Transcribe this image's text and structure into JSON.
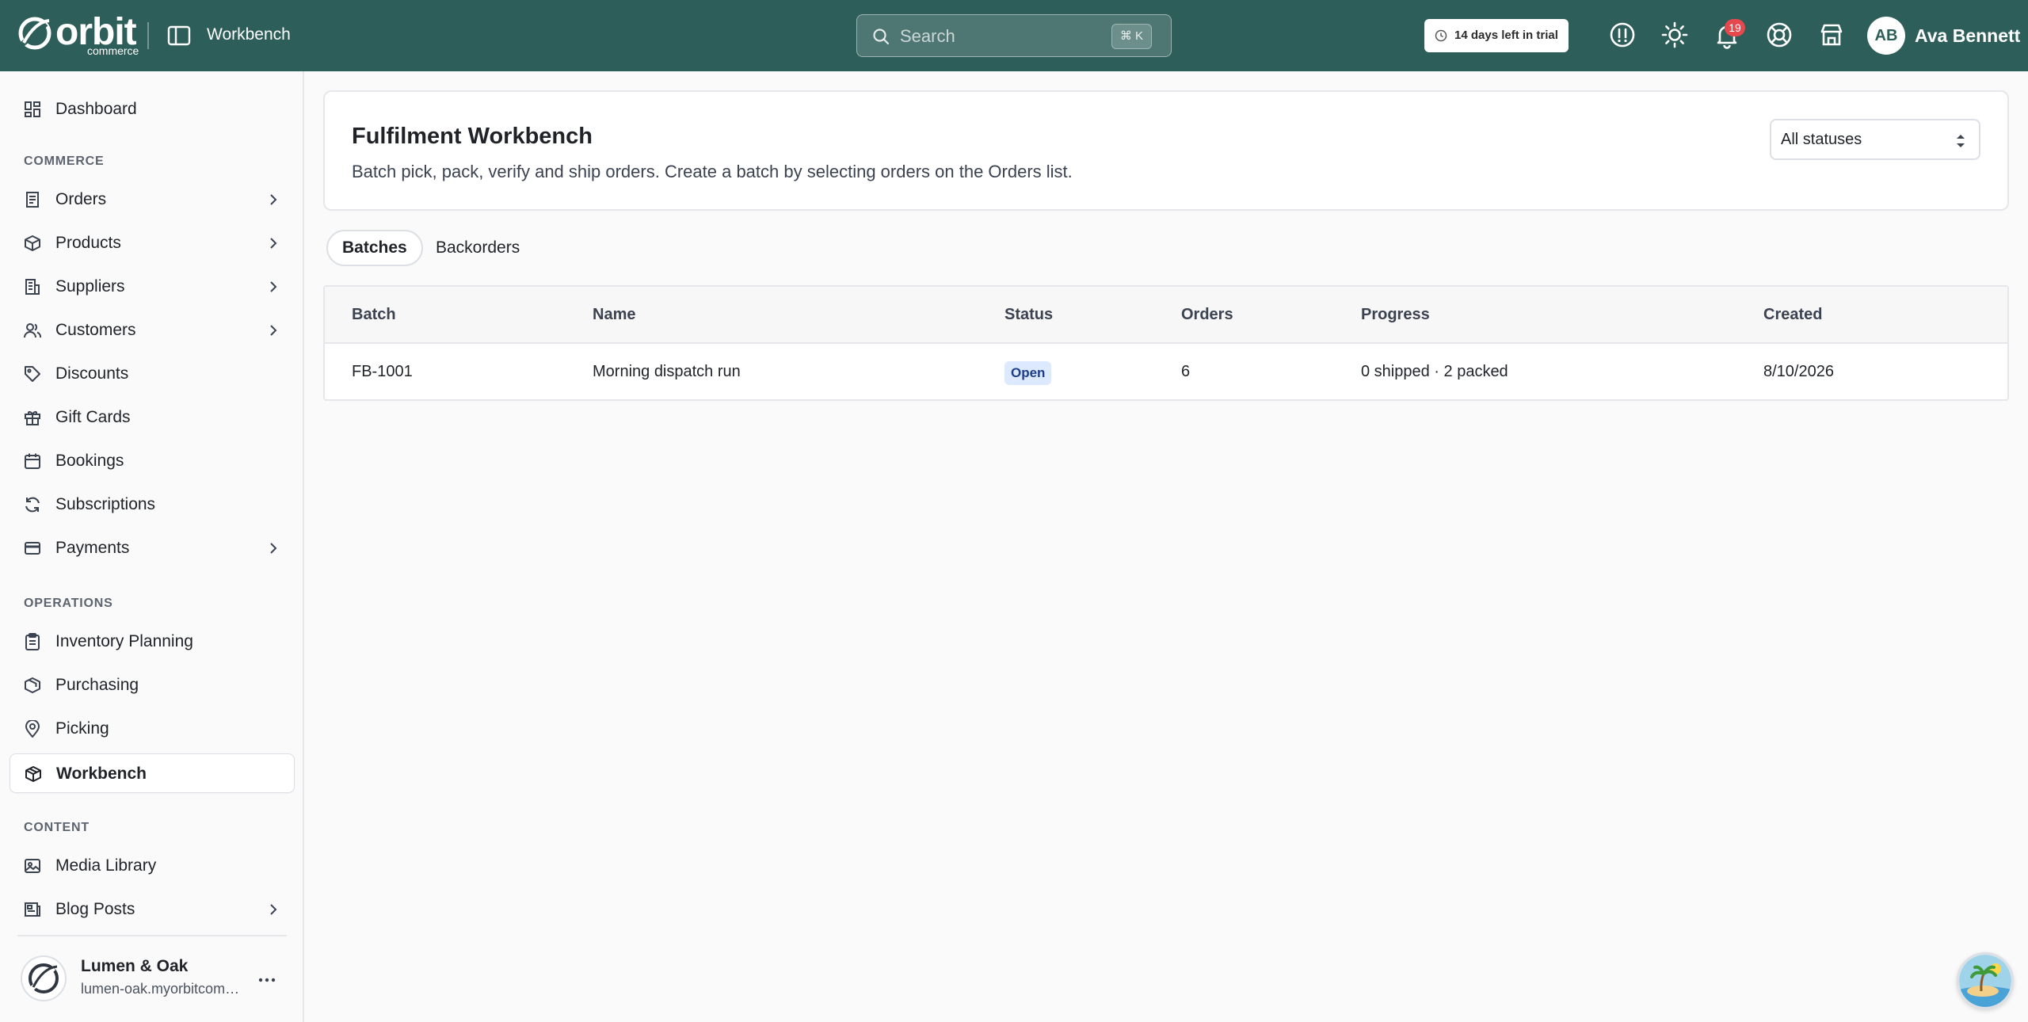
{
  "topbar": {
    "logo_word": "orbit",
    "logo_sub": "commerce",
    "page_label": "Workbench",
    "search_placeholder": "Search",
    "search_shortcut": "⌘ K",
    "trial_text": "14 days left in trial",
    "notification_count": "19",
    "user_initials": "AB",
    "user_name": "Ava Bennett",
    "icons": [
      "sidebar-toggle-icon",
      "search-icon",
      "clock-icon",
      "alert-icon",
      "sun-icon",
      "bell-icon",
      "lifebuoy-icon",
      "storefront-icon"
    ],
    "bar_color": "#2d5e59"
  },
  "sidebar": {
    "items": [
      {
        "label": "Dashboard",
        "icon": "dashboard-icon"
      },
      {
        "label": "Orders",
        "icon": "receipt-icon",
        "expandable": true
      },
      {
        "label": "Products",
        "icon": "box-icon",
        "expandable": true
      },
      {
        "label": "Suppliers",
        "icon": "building-icon",
        "expandable": true
      },
      {
        "label": "Customers",
        "icon": "users-icon",
        "expandable": true
      },
      {
        "label": "Discounts",
        "icon": "tag-icon"
      },
      {
        "label": "Gift Cards",
        "icon": "gift-icon"
      },
      {
        "label": "Bookings",
        "icon": "calendar-icon"
      },
      {
        "label": "Subscriptions",
        "icon": "refresh-icon"
      },
      {
        "label": "Payments",
        "icon": "credit-card-icon",
        "expandable": true
      },
      {
        "label": "Inventory Planning",
        "icon": "clipboard-icon"
      },
      {
        "label": "Purchasing",
        "icon": "cart-box-icon"
      },
      {
        "label": "Picking",
        "icon": "map-pin-icon"
      },
      {
        "label": "Workbench",
        "icon": "package-icon",
        "active": true
      },
      {
        "label": "Media Library",
        "icon": "image-icon"
      },
      {
        "label": "Blog Posts",
        "icon": "newspaper-icon",
        "expandable": true
      }
    ],
    "sections": {
      "commerce": "COMMERCE",
      "operations": "OPERATIONS",
      "content": "CONTENT"
    },
    "store": {
      "name": "Lumen & Oak",
      "url": "lumen-oak.myorbitcommerce.com"
    }
  },
  "main": {
    "title": "Fulfilment Workbench",
    "description": "Batch pick, pack, verify and ship orders. Create a batch by selecting orders on the Orders list.",
    "status_filter": {
      "selected": "All statuses"
    },
    "tabs": [
      {
        "label": "Batches",
        "active": true
      },
      {
        "label": "Backorders",
        "active": false
      }
    ],
    "table": {
      "columns": [
        "Batch",
        "Name",
        "Status",
        "Orders",
        "Progress",
        "Created"
      ],
      "rows": [
        {
          "batch": "FB-1001",
          "name": "Morning dispatch run",
          "status": "Open",
          "orders": "6",
          "progress": "0 shipped · 2 packed",
          "created": "8/10/2026"
        }
      ]
    }
  }
}
